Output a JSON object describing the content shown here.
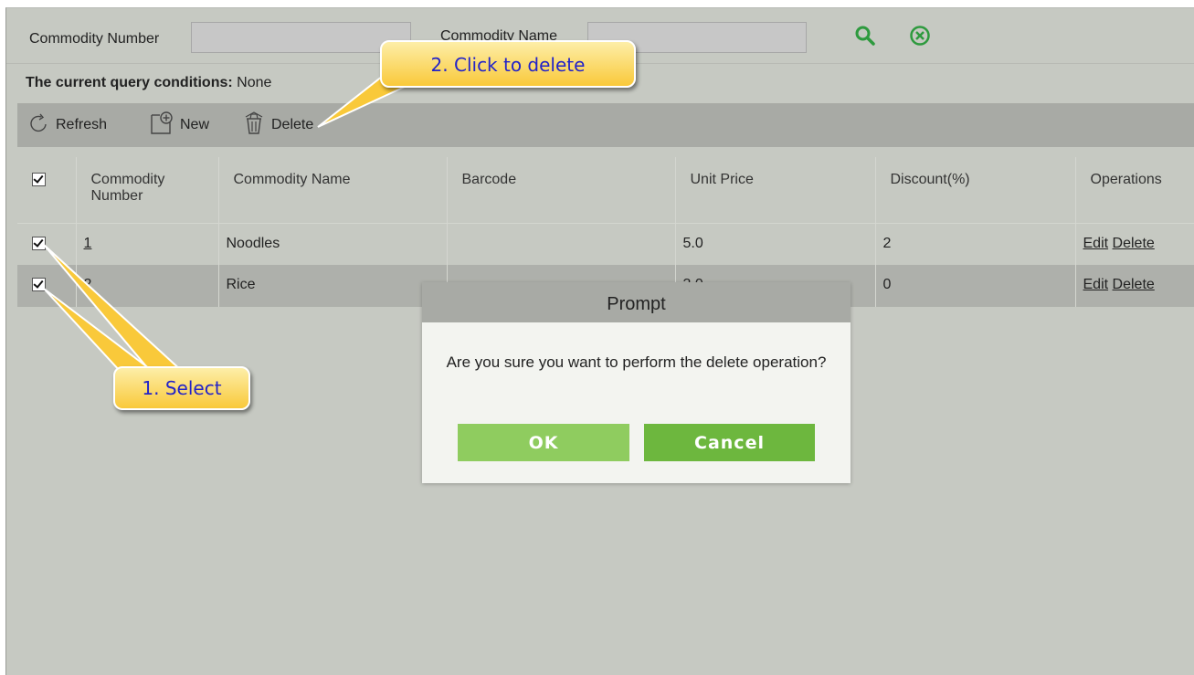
{
  "search": {
    "number_label": "Commodity Number",
    "number_value": "",
    "name_label": "Commodity Name",
    "name_value": ""
  },
  "query": {
    "label": "The current query conditions:",
    "value": "None"
  },
  "toolbar": {
    "refresh": "Refresh",
    "new": "New",
    "delete": "Delete"
  },
  "table": {
    "headers": [
      "Commodity Number",
      "Commodity Name",
      "Barcode",
      "Unit Price",
      "Discount(%)",
      "Operations"
    ],
    "rows": [
      {
        "number": "1",
        "name": "Noodles",
        "barcode": "",
        "unit_price": "5.0",
        "discount": "2",
        "edit": "Edit",
        "delete": "Delete"
      },
      {
        "number": "2",
        "name": "Rice",
        "barcode": "",
        "unit_price": "3.0",
        "discount": "0",
        "edit": "Edit",
        "delete": "Delete"
      }
    ]
  },
  "dialog": {
    "title": "Prompt",
    "message": "Are you sure you want to perform the delete operation?",
    "ok": "OK",
    "cancel": "Cancel"
  },
  "callouts": {
    "select": "1. Select",
    "delete": "2. Click to delete"
  },
  "colors": {
    "accent_green": "#6db73e",
    "callout_yellow": "#f9c93a",
    "callout_text": "#2323c8",
    "search_icon": "#2e9a3e"
  }
}
